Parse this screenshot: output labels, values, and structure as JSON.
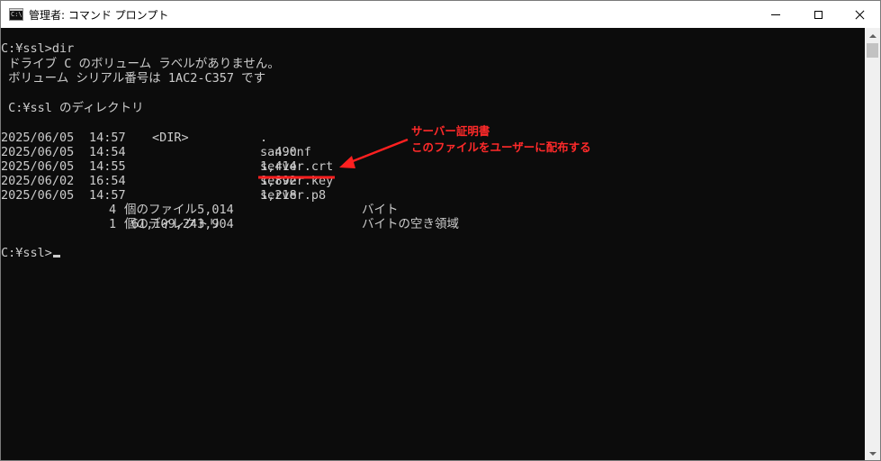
{
  "window": {
    "title": "管理者: コマンド プロンプト",
    "icon_text": "C:\\."
  },
  "console": {
    "lines": [
      "C:¥ssl>dir",
      " ドライブ C のボリューム ラベルがありません。",
      " ボリューム シリアル番号は 1AC2-C357 です",
      "",
      " C:¥ssl のディレクトリ",
      ""
    ],
    "entries": [
      {
        "date": "2025/06/05",
        "time": "14:57",
        "type": "<DIR>",
        "size": "",
        "name": "."
      },
      {
        "date": "2025/06/05",
        "time": "14:54",
        "type": "",
        "size": "490",
        "name": "san.cnf"
      },
      {
        "date": "2025/06/05",
        "time": "14:55",
        "type": "",
        "size": "1,414",
        "name": "server.crt"
      },
      {
        "date": "2025/06/02",
        "time": "16:54",
        "type": "",
        "size": "1,892",
        "name": "server.key"
      },
      {
        "date": "2025/06/05",
        "time": "14:57",
        "type": "",
        "size": "1,218",
        "name": "server.p8"
      }
    ],
    "summary": [
      {
        "count": "4",
        "label": "個のファイル",
        "amount": "5,014",
        "unit": "バイト"
      },
      {
        "count": "1",
        "label": "個のディレクトリ",
        "amount": "61,109,243,904",
        "unit": "バイトの空き領域"
      }
    ],
    "prompt": "C:¥ssl>"
  },
  "annotation": {
    "line1": "サーバー証明書",
    "line2": "このファイルをユーザーに配布する",
    "color": "#ff2a2a"
  },
  "colors": {
    "console_bg": "#0c0c0c",
    "console_fg": "#cccccc",
    "annotation": "#ff2a2a"
  }
}
